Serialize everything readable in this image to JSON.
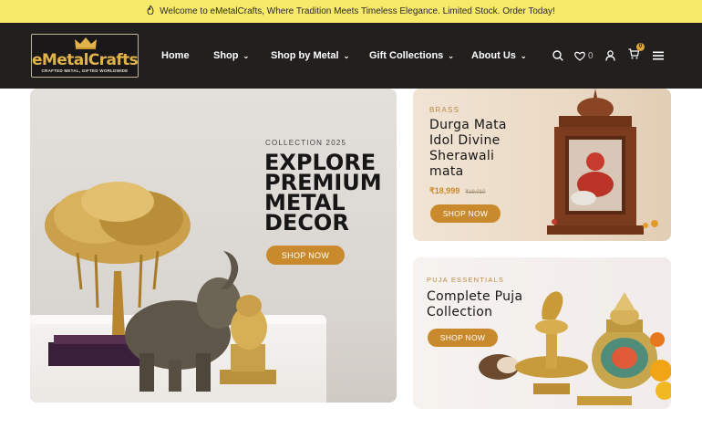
{
  "announcement": {
    "icon": "fire-icon",
    "text": "Welcome to eMetalCrafts, Where Tradition Meets Timeless Elegance. Limited Stock. Order Today!"
  },
  "logo": {
    "brand": "eMetalCrafts",
    "tagline": "CRAFTED METAL, GIFTED WORLDWIDE"
  },
  "nav": {
    "items": [
      {
        "label": "Home"
      },
      {
        "label": "Shop"
      },
      {
        "label": "Shop by Metal"
      },
      {
        "label": "Gift Collections"
      },
      {
        "label": "About Us"
      }
    ],
    "wishlist_count": "0",
    "cart_count": "0"
  },
  "hero": {
    "eyebrow": "COLLECTION 2025",
    "headline_lines": [
      "EXPLORE",
      "PREMIUM",
      "METAL",
      "DECOR"
    ],
    "cta": "SHOP NOW"
  },
  "card1": {
    "eyebrow": "BRASS",
    "title_lines": [
      "Durga Mata",
      "Idol Divine",
      "Sherawali",
      "mata"
    ],
    "price": "₹18,999",
    "old_price": "₹19,010",
    "cta": "SHOP NOW"
  },
  "card2": {
    "eyebrow": "PUJA ESSENTIALS",
    "title_lines": [
      "Complete Puja",
      "Collection"
    ],
    "cta": "SHOP NOW"
  },
  "colors": {
    "accent": "#c98a2e",
    "nav_bg": "#221f1f",
    "announce_bg": "#f7ea6b",
    "gold": "#e0b24a"
  }
}
